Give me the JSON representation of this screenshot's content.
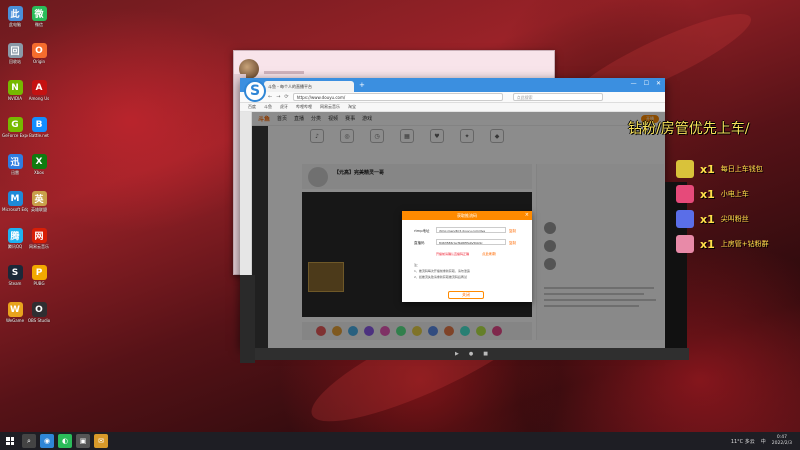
{
  "desktop": {
    "icons": [
      {
        "label": "此电脑",
        "color": "#4a90d9"
      },
      {
        "label": "回收站",
        "color": "#8a9aa8"
      },
      {
        "label": "NVIDIA",
        "color": "#76b900"
      },
      {
        "label": "GeForce Experience",
        "color": "#76b900"
      },
      {
        "label": "迅雷",
        "color": "#2f7de1"
      },
      {
        "label": "Microsoft Edge",
        "color": "#1f8ad8"
      },
      {
        "label": "腾讯QQ",
        "color": "#1fb1f0"
      },
      {
        "label": "Steam",
        "color": "#1b2838"
      },
      {
        "label": "WeGame",
        "color": "#e8a31d"
      },
      {
        "label": "微信",
        "color": "#2bbc5a"
      },
      {
        "label": "Origin",
        "color": "#f56c2d"
      },
      {
        "label": "Among Us",
        "color": "#c51111"
      },
      {
        "label": "Battle.net",
        "color": "#148eff"
      },
      {
        "label": "Xbox",
        "color": "#107c10"
      },
      {
        "label": "英雄联盟",
        "color": "#c9a04a"
      },
      {
        "label": "网易云音乐",
        "color": "#d81e06"
      },
      {
        "label": "PUBG",
        "color": "#f2a900"
      },
      {
        "label": "OBS Studio",
        "color": "#302e31"
      }
    ]
  },
  "back_window": {
    "title": ""
  },
  "browser": {
    "tab_title": "斗鱼 - 每个人的直播平台",
    "url": "https://www.douyu.com/",
    "search_placeholder": "点此搜索",
    "bookmarks": [
      "百度",
      "斗鱼",
      "虎牙",
      "哔哩哔哩",
      "网易云音乐",
      "淘宝"
    ],
    "nav_back": "←",
    "nav_forward": "→",
    "nav_refresh": "⟳",
    "win_min": "—",
    "win_max": "☐",
    "win_close": "✕"
  },
  "site": {
    "logo": "斗鱼",
    "nav": [
      "首页",
      "直播",
      "分类",
      "视频",
      "赛事",
      "游戏"
    ],
    "open_live_btn": "开播",
    "stream_title": "【元高】完美精灵一哥",
    "categories": [
      "♪",
      "◎",
      "◷",
      "▦",
      "♥",
      "✦",
      "◆"
    ]
  },
  "modal": {
    "title": "获取推流码",
    "label_url": "rtmp地址",
    "url_value": "rtmp://sendtc3.douyu.com/live",
    "copy_label": "复制",
    "label_code": "直播码",
    "code_value": "8463586rGvfbzREPa9v5bb9c",
    "warn": "开播前请确认直播码正确",
    "refresh_link": "点此刷新",
    "note_title": "注：",
    "note_1": "1、推流码每次开播前重新获取，请勿泄露",
    "note_2": "2、如推流失败请重新获取推流码后再试",
    "ok_btn": "关闭"
  },
  "overlay": {
    "title": "钻粉/房管优先上车/",
    "rows": [
      {
        "mult": "x1",
        "label": "每日上车钱包",
        "color": "#d9c23a"
      },
      {
        "mult": "x1",
        "label": "小电上车",
        "color": "#e64a7a"
      },
      {
        "mult": "x1",
        "label": "尖叫粉丝",
        "color": "#5a6ee8"
      },
      {
        "mult": "x1",
        "label": "上房管+钻粉群",
        "color": "#e88aa8"
      }
    ]
  },
  "taskbar": {
    "apps": [
      "⌕",
      "◉",
      "◐",
      "▣",
      "✉"
    ],
    "weather": "11°C 多云",
    "lang": "中",
    "time": "0:47",
    "date": "2022/2/3"
  },
  "colors": {
    "accent": "#ff8a00",
    "browser_blue": "#3b8fe0",
    "overlay_yellow": "#ffe04a"
  }
}
